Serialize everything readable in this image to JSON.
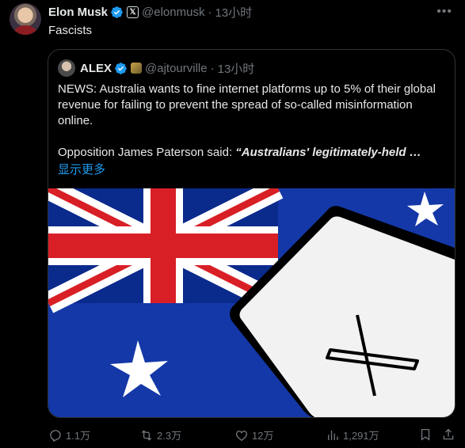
{
  "tweet": {
    "author_name": "Elon Musk",
    "handle": "@elonmusk",
    "separator": "·",
    "time": "13小时",
    "text": "Fascists"
  },
  "quote": {
    "author_name": "ALEX",
    "handle": "@ajtourville",
    "separator": "·",
    "time": "13小时",
    "para1": "NEWS: Australia wants to fine internet platforms up to 5% of their global revenue for failing to prevent the spread of so-called misinformation online.",
    "para2_prefix": "Opposition James Paterson said: ",
    "para2_quote": "“Australians' legitimately-held …",
    "show_more": "显示更多"
  },
  "actions": {
    "replies": "1.1万",
    "reposts": "2.3万",
    "likes": "12万",
    "views": "1,291万"
  },
  "colors": {
    "background": "#000000",
    "text": "#e7e9ea",
    "muted": "#71767b",
    "link": "#1d9bf0",
    "verified": "#1d9bf0",
    "border": "#2f3336"
  },
  "icons": [
    "verified-icon",
    "x-affiliate-icon",
    "more-icon",
    "reply-icon",
    "repost-icon",
    "like-icon",
    "views-icon",
    "bookmark-icon",
    "share-icon"
  ]
}
